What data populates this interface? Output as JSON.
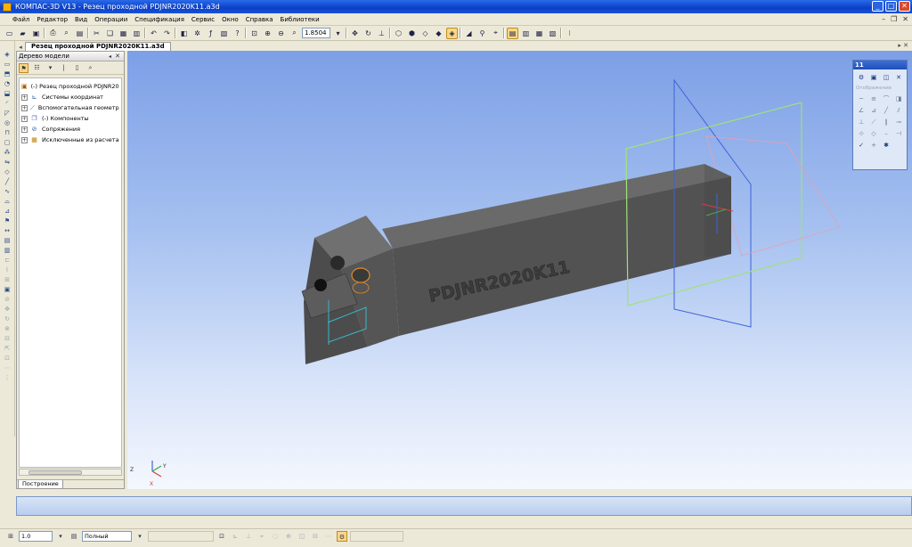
{
  "window": {
    "title": "КОМПАС-3D V13 - Резец проходной PDJNR2020K11.a3d",
    "controls": [
      "_",
      "□",
      "✕"
    ]
  },
  "menu": [
    "Файл",
    "Редактор",
    "Вид",
    "Операции",
    "Спецификация",
    "Сервис",
    "Окно",
    "Справка",
    "Библиотеки"
  ],
  "toolbar": {
    "zoom_value": "1.8504"
  },
  "document_tab": {
    "label": "Резец проходной PDJNR2020K11.a3d"
  },
  "model_tree": {
    "title": "Дерево модели",
    "items": [
      {
        "label": "(-) Резец проходной PDJNR2020",
        "icon": "part-icon",
        "root": true
      },
      {
        "label": "Системы координат",
        "icon": "coordinate-system-icon"
      },
      {
        "label": "Вспомогательная геометри",
        "icon": "aux-geometry-icon"
      },
      {
        "label": "(-) Компоненты",
        "icon": "components-icon"
      },
      {
        "label": "Сопряжения",
        "icon": "mates-icon"
      },
      {
        "label": "Исключенные из расчета",
        "icon": "excluded-icon"
      }
    ],
    "bottom_tab": "Построение"
  },
  "viewport": {
    "engraving": "PDJNR2020K11",
    "axis_labels": {
      "z": "Z",
      "x": "X",
      "y": "Y"
    }
  },
  "float_panel": {
    "title": "11",
    "section_label": "Отображение"
  },
  "property_bar": {
    "step_value": "1.0",
    "mode_value": "Полный"
  },
  "colors": {
    "title_bar": "#0a3fc7",
    "viewport_top": "#7d9fe6",
    "viewport_bottom": "#f4f7fd",
    "plane_green": "#9fe27a",
    "plane_blue": "#3f62d8",
    "plane_red": "#e6a0b0"
  }
}
